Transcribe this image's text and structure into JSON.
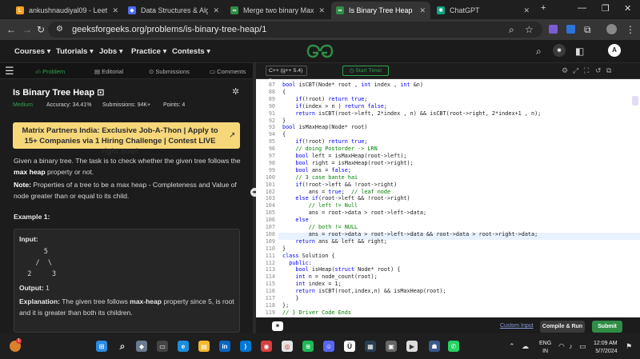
{
  "browser": {
    "tabs": [
      {
        "title": "ankushnaudiyal09 - LeetCode",
        "active": false
      },
      {
        "title": "Data Structures & Algorithms",
        "active": false
      },
      {
        "title": "Merge two binary Max heap",
        "active": false
      },
      {
        "title": "Is Binary Tree Heap | Practice",
        "active": true
      },
      {
        "title": "ChatGPT",
        "active": false
      }
    ],
    "url": "geeksforgeeks.org/problems/is-binary-tree-heap/1"
  },
  "site": {
    "nav": [
      "Courses",
      "Tutorials",
      "Jobs",
      "Practice",
      "Contests"
    ],
    "avatar": "A"
  },
  "left_tabs": [
    "Problem",
    "Editorial",
    "Submissions",
    "Comments"
  ],
  "problem": {
    "title": "Is Binary Tree Heap",
    "difficulty": "Medium",
    "accuracy": "Accuracy: 34.41%",
    "submissions": "Submissions: 94K+",
    "points": "Points: 4",
    "banner": "Matrix Partners India: Exclusive Job-A-Thon | Apply to 15+ Companies via 1 Hiring Challenge | Contest LIVE right now!",
    "desc1a": "Given a binary tree. The task is to check whether the given tree follows the ",
    "desc1b": "max heap",
    "desc1c": " property or not.",
    "note_label": "Note:",
    "note_text": " Properties of a tree to be a max heap - Completeness and Value of node greater than or equal to its child.",
    "example_title": "Example 1:",
    "input_label": "Input:",
    "tree_lines": [
      "      5",
      "    /  \\",
      "  2     3"
    ],
    "output_label": "Output:",
    "output_value": "1",
    "expl_label": "Explanation:",
    "expl_text1": " The given tree follows ",
    "expl_bold": "max-heap",
    "expl_text2": " property since 5, is root and it is greater than both its children."
  },
  "editor": {
    "language": "C++ (g++ 5.4)",
    "timer": "Start Timer",
    "lines": [
      {
        "n": "87",
        "code": "bool isCBT(Node* root , int index , int &n)"
      },
      {
        "n": "88",
        "code": "{"
      },
      {
        "n": "89",
        "code": "    if(!root) return true;"
      },
      {
        "n": "90",
        "code": "    if(index > n ) return false;"
      },
      {
        "n": "91",
        "code": "    return isCBT(root->left, 2*index , n) && isCBT(root->right, 2*index+1 , n);"
      },
      {
        "n": "92",
        "code": "}"
      },
      {
        "n": "93",
        "code": "bool isMaxHeap(Node* root)"
      },
      {
        "n": "94",
        "code": "{"
      },
      {
        "n": "95",
        "code": "    if(!root) return true;"
      },
      {
        "n": "96",
        "code": "    // doing Postorder -> LRN"
      },
      {
        "n": "97",
        "code": "    bool left = isMaxHeap(root->left);"
      },
      {
        "n": "98",
        "code": "    bool right = isMaxHeap(root->right);"
      },
      {
        "n": "99",
        "code": "    bool ans = false;"
      },
      {
        "n": "100",
        "code": "    // 3 case bante hai"
      },
      {
        "n": "101",
        "code": "    if(!root->left && !root->right)"
      },
      {
        "n": "102",
        "code": "        ans = true;  // leaf node"
      },
      {
        "n": "103",
        "code": "    else if(root->left && !root->right)"
      },
      {
        "n": "104",
        "code": "        // left != Null"
      },
      {
        "n": "105",
        "code": "        ans = root->data > root->left->data;"
      },
      {
        "n": "106",
        "code": "    else"
      },
      {
        "n": "107",
        "code": "        // both != NULL"
      },
      {
        "n": "108",
        "code": "        ans = root->data > root->left->data && root->data > root->right->data;"
      },
      {
        "n": "109",
        "code": "    return ans && left && right;"
      },
      {
        "n": "110",
        "code": "}"
      },
      {
        "n": "111",
        "code": "class Solution {"
      },
      {
        "n": "112",
        "code": "  public:"
      },
      {
        "n": "113",
        "code": "    bool isHeap(struct Node* root) {"
      },
      {
        "n": "114",
        "code": "    int n = node_count(root);"
      },
      {
        "n": "115",
        "code": "    int index = 1;"
      },
      {
        "n": "116",
        "code": "    return isCBT(root,index,n) && isMaxHeap(root);"
      },
      {
        "n": "117",
        "code": "    }"
      },
      {
        "n": "118",
        "code": "};"
      },
      {
        "n": "119",
        "code": "// } Driver Code Ends"
      }
    ],
    "custom_input": "Custom Input",
    "compile_run": "Compile & Run",
    "submit": "Submit"
  },
  "taskbar": {
    "lang": "ENG",
    "region": "IN",
    "time": "12:09 AM",
    "date": "5/7/2024"
  }
}
